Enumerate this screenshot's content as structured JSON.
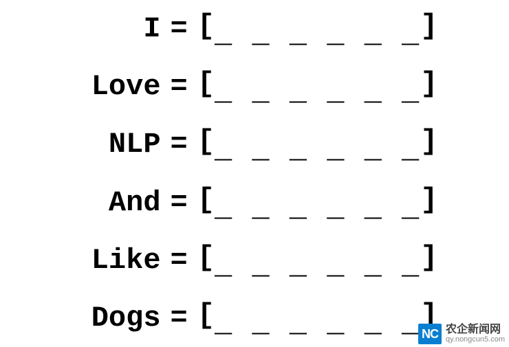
{
  "rows": [
    {
      "word": "I",
      "vector_placeholder": "_ _ _ _ _ _"
    },
    {
      "word": "Love",
      "vector_placeholder": "_ _ _ _ _ _"
    },
    {
      "word": "NLP",
      "vector_placeholder": "_ _ _ _ _ _"
    },
    {
      "word": "And",
      "vector_placeholder": "_ _ _ _ _ _"
    },
    {
      "word": "Like",
      "vector_placeholder": "_ _ _ _ _ _"
    },
    {
      "word": "Dogs",
      "vector_placeholder": "_ _ _ _ _ _"
    }
  ],
  "equals": "=",
  "bracket_open": "[",
  "bracket_close": "]",
  "watermark": {
    "logo_text": "NC",
    "cn": "农企新闻网",
    "url": "qy.nongcun5.com"
  }
}
